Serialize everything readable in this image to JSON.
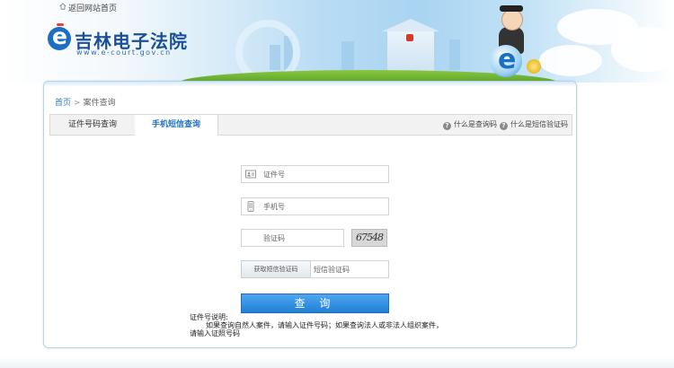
{
  "header": {
    "back_link": "返回网站首页",
    "logo_title": "吉林电子法院",
    "logo_url": "www.e-court.gov.cn"
  },
  "breadcrumb": {
    "home": "首页",
    "separator": ">",
    "current": "案件查询"
  },
  "tabs": [
    {
      "label": "证件号码查询",
      "active": false
    },
    {
      "label": "手机短信查询",
      "active": true
    }
  ],
  "help_links": [
    {
      "label": "什么是查询码",
      "icon": "question-icon"
    },
    {
      "label": "什么是短信验证码",
      "icon": "question-icon"
    }
  ],
  "form": {
    "id_placeholder": "证件号",
    "phone_placeholder": "手机号",
    "captcha_placeholder": "验证码",
    "captcha_text": "67548",
    "sms_button": "获取短信验证码",
    "sms_placeholder": "短信验证码",
    "submit": "查 询"
  },
  "note": {
    "line1": "证件号说明:",
    "line2": "如果查询自然人案件，请输入证件号码；如果查询法人或非法人组织案件，",
    "line3": "请输入证照号码"
  },
  "colors": {
    "accent": "#1f7fd6",
    "tab_active_text": "#1e73c8",
    "logo_blue": "#1a4f9a"
  }
}
